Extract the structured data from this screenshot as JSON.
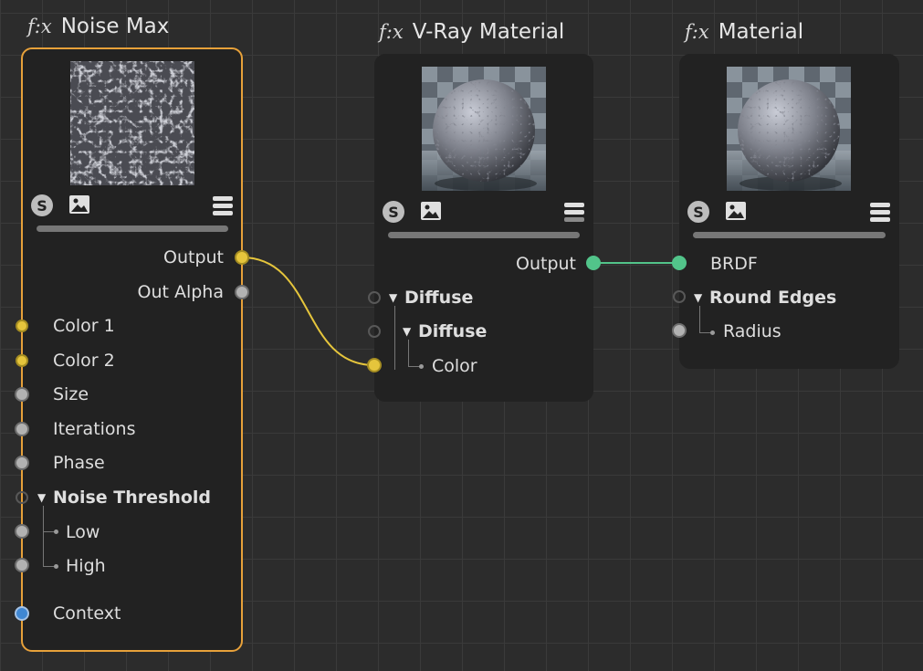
{
  "nodes": {
    "noise_max": {
      "title": "Noise Max",
      "fx": "f:x",
      "outputs": [
        "Output",
        "Out Alpha"
      ],
      "inputs": [
        "Color 1",
        "Color 2",
        "Size",
        "Iterations",
        "Phase"
      ],
      "group": "Noise Threshold",
      "group_children": [
        "Low",
        "High"
      ],
      "context": "Context"
    },
    "vray_material": {
      "title": "V-Ray Material",
      "fx": "f:x",
      "output": "Output",
      "group": "Diffuse",
      "subgroup": "Diffuse",
      "child": "Color"
    },
    "material": {
      "title": "Material",
      "fx": "f:x",
      "input": "BRDF",
      "group": "Round Edges",
      "child": "Radius"
    }
  },
  "icons": {
    "shader": "s-circle-icon",
    "image": "image-icon",
    "menu": "hamburger-menu-icon"
  },
  "colors": {
    "selected_border": "#e7a13a",
    "color_port": "#e5c53c",
    "float_port": "#b2b2b2",
    "material_port": "#52c48a",
    "context_port": "#3f87d3"
  }
}
